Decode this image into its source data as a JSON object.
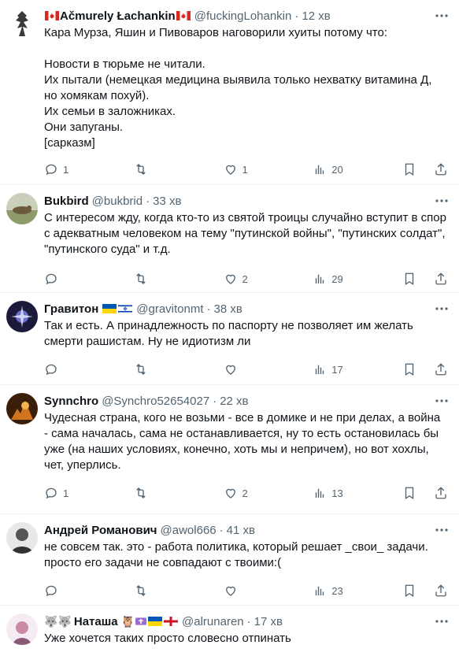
{
  "tweets": [
    {
      "name": "Аčmurely Łachankin",
      "handle": "@fuckingLohankin",
      "time": "12 хв",
      "text": "Кара Мурза, Яшин и Пивоваров наговорили хуиты потому что:\n\nНовости в тюрьме не читали.\nИх пытали (немецкая медицина выявила только нехватку витамина Д, но хомякам похуй).\nИх семьи в заложниках.\nОни запуганы.\n[сарказм]",
      "replies": "1",
      "reposts": "",
      "likes": "1",
      "views": "20"
    },
    {
      "name": "Bukbird",
      "handle": "@bukbrid",
      "time": "33 хв",
      "text": "С интересом жду, когда кто-то из святой троицы случайно вступит в спор с адекватным человеком на тему \"путинской войны\", \"путинских солдат\", \"путинского суда\" и т.д.",
      "replies": "",
      "reposts": "",
      "likes": "2",
      "views": "29"
    },
    {
      "name": "Гравитон",
      "handle": "@gravitonmt",
      "time": "38 хв",
      "text": "Так и есть. А принадлежность по паспорту не позволяет им желать смерти рашистам. Ну не идиотизм ли",
      "replies": "",
      "reposts": "",
      "likes": "",
      "views": "17"
    },
    {
      "name": "Synnchro",
      "handle": "@Synchro52654027",
      "time": "22 хв",
      "text": "Чудесная страна, кого не возьми - все в домике и не при делах, а война - сама началась, сама не останавливается, ну то есть остановилась бы уже (на наших условиях, конечно, хоть мы и непричем), но вот хохлы, чет, уперлись.",
      "replies": "1",
      "reposts": "",
      "likes": "2",
      "views": "13"
    },
    {
      "name": "Андрей Романович",
      "handle": "@awol666",
      "time": "41 хв",
      "text": "не совсем так. это - работа политика, который решает _свои_ задачи. просто его задачи не совпадают с твоими:(",
      "replies": "",
      "reposts": "",
      "likes": "",
      "views": "23"
    },
    {
      "name": "Наташа",
      "handle": "@alrunaren",
      "time": "17 хв",
      "text": "Уже хочется таких просто словесно отпинать",
      "replies": "",
      "reposts": "",
      "likes": "",
      "views": ""
    }
  ],
  "colors": {
    "text": "#0f1419",
    "secondary": "#536471",
    "divider": "#eff3f4"
  }
}
